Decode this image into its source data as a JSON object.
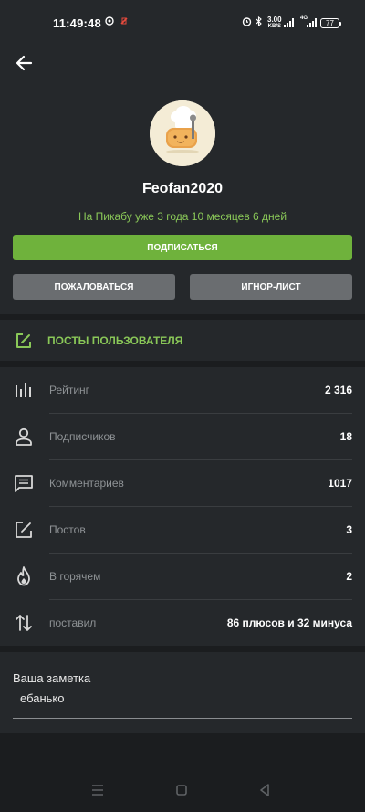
{
  "status_bar": {
    "time": "11:49:48",
    "speed_value": "3.00",
    "speed_unit": "KB/S",
    "network": "4G",
    "battery": "77",
    "icons": [
      "notification-icon",
      "no-sim-alert-icon",
      "alarm-icon",
      "bluetooth-icon",
      "signal-icon",
      "battery-icon"
    ]
  },
  "profile": {
    "back_icon": "arrow-left-icon",
    "avatar_icon": "chef-hat-bread-avatar",
    "username": "Feofan2020",
    "since": "На Пикабу уже 3 года 10 месяцев 6 дней",
    "subscribe_label": "ПОДПИСАТЬСЯ",
    "complain_label": "ПОЖАЛОВАТЬСЯ",
    "ignore_label": "ИГНОР-ЛИСТ"
  },
  "posts": {
    "icon": "edit-square-icon",
    "label": "ПОСТЫ ПОЛЬЗОВАТЕЛЯ"
  },
  "stats": [
    {
      "icon": "bar-chart-icon",
      "label": "Рейтинг",
      "value": "2 316"
    },
    {
      "icon": "person-icon",
      "label": "Подписчиков",
      "value": "18"
    },
    {
      "icon": "comment-icon",
      "label": "Комментариев",
      "value": "1017"
    },
    {
      "icon": "edit-square-icon",
      "label": "Постов",
      "value": "3"
    },
    {
      "icon": "fire-icon",
      "label": "В горячем",
      "value": "2"
    },
    {
      "icon": "swap-vertical-icon",
      "label": "поставил",
      "value": "86 плюсов и 32 минуса"
    }
  ],
  "note": {
    "label": "Ваша заметка",
    "value": "ебанько"
  },
  "nav": {
    "icons": [
      "menu-icon",
      "home-square-icon",
      "back-triangle-icon"
    ]
  },
  "colors": {
    "accent_green": "#8ac858",
    "button_green": "#6fb23c",
    "button_gray": "#6a6d70",
    "card_bg": "#25282b",
    "page_bg": "#1b1d1f"
  }
}
